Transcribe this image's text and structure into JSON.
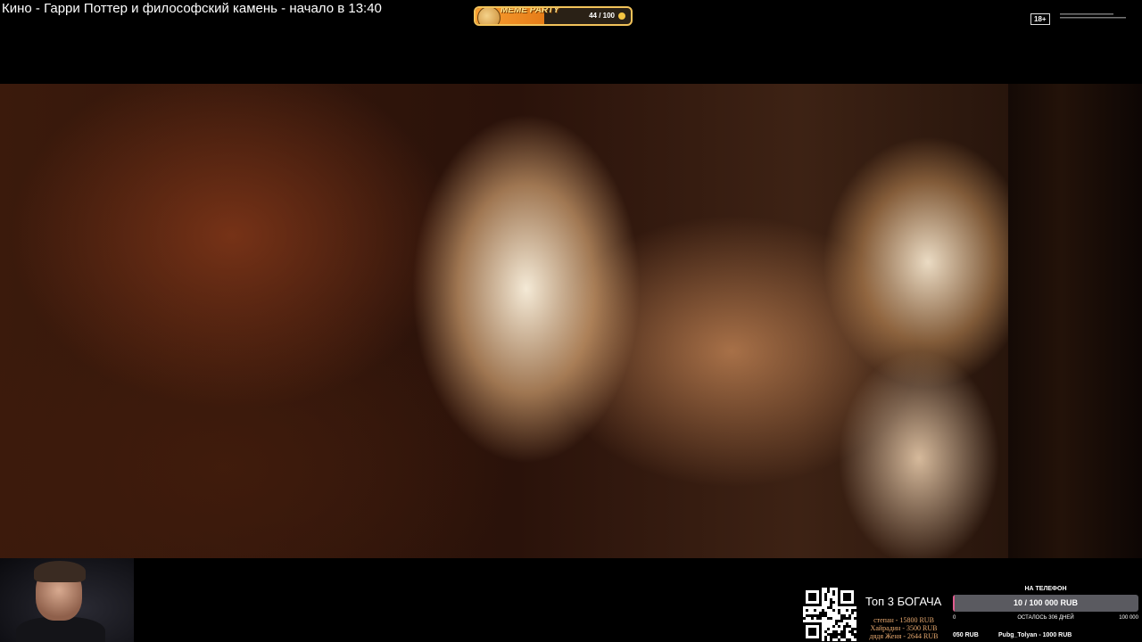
{
  "stream": {
    "title": "Кино - Гарри Поттер и философский камень -  начало в 13:40"
  },
  "meme_party": {
    "label": "MEME PARTY",
    "count_text": "44 / 100",
    "progress": 0.44,
    "icon": "coin-icon",
    "logo": "doge-logo",
    "accent": "#f2c35a"
  },
  "age_rating": {
    "badge": "18+"
  },
  "video": {
    "scene": "fire"
  },
  "donation": {
    "qr": "qr-code",
    "top_title": "Топ 3 БОГАЧА",
    "top_list": [
      "степан - 15800 RUB",
      "Хайрадин - 3500 RUB",
      "дядя Женя - 2644 RUB"
    ]
  },
  "goal": {
    "label": "НА ТЕЛЕФОН",
    "value_text": "10 / 100 000 RUB",
    "progress": 0.0001,
    "min": "0",
    "max": "100 000",
    "days_left": "ОСТАЛОСЬ 306 ДНЕЙ",
    "fill_color": "#e05a8d"
  },
  "ticker": {
    "left": "050 RUB",
    "right": "Pubg_Tolyan - 1000 RUB"
  }
}
